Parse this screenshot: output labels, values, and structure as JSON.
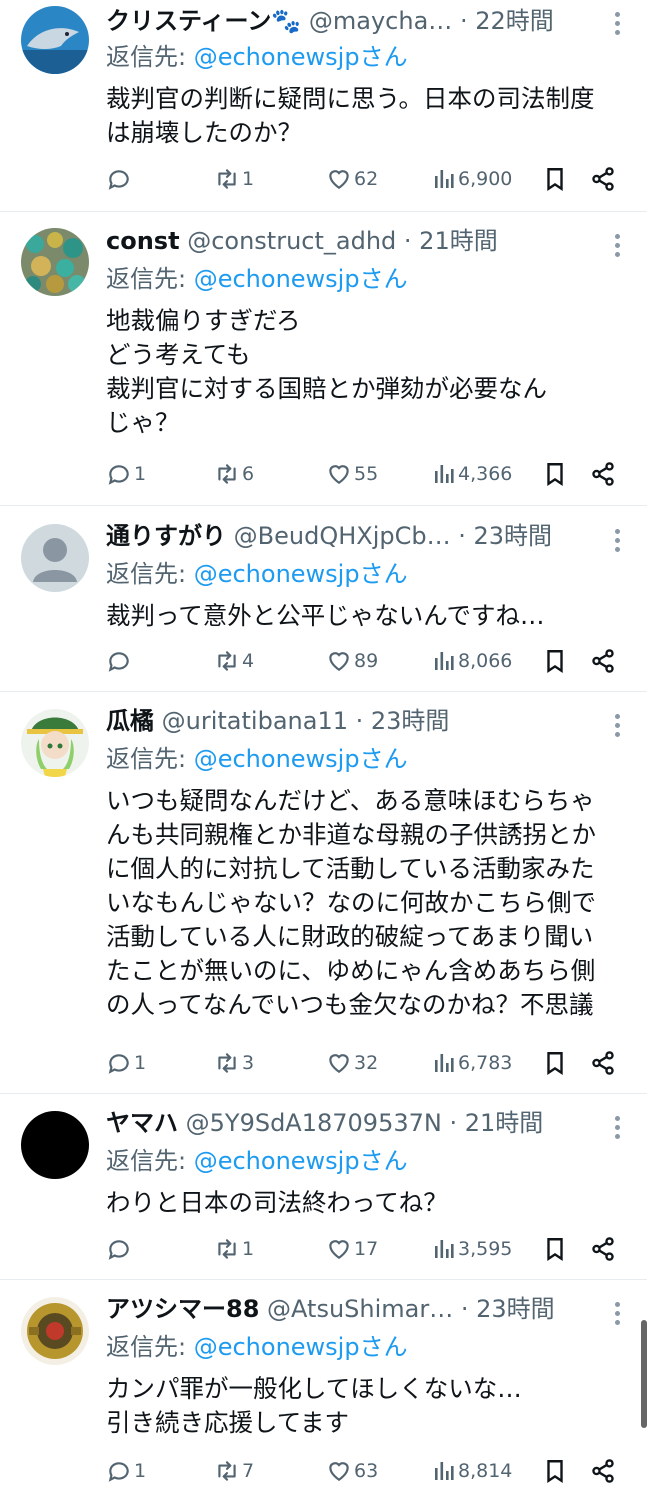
{
  "reply_prefix": "返信先: ",
  "tweets": [
    {
      "name": "クリスティーン🐾",
      "handle": "@maycha…",
      "time": "· 22時間",
      "reply_to": "@echonewsjpさん",
      "lines": [
        "裁判官の判断に疑問に思う。日本の司法制度",
        "は崩壊したのか？"
      ],
      "replies": "",
      "retweets": "1",
      "likes": "62",
      "views": "6,900",
      "avatar": "dolphin"
    },
    {
      "name": "const",
      "handle": "@construct_adhd",
      "time": "· 21時間",
      "reply_to": "@echonewsjpさん",
      "lines": [
        "地裁偏りすぎだろ",
        "どう考えても",
        "裁判官に対する国賠とか弾劾が必要なん",
        "じゃ？"
      ],
      "replies": "1",
      "retweets": "6",
      "likes": "55",
      "views": "4,366",
      "avatar": "gravel"
    },
    {
      "name": "通りすがり",
      "handle": "@BeudQHXjpCb…",
      "time": "· 23時間",
      "reply_to": "@echonewsjpさん",
      "lines": [
        "裁判って意外と公平じゃないんですね…"
      ],
      "replies": "",
      "retweets": "4",
      "likes": "89",
      "views": "8,066",
      "avatar": "default"
    },
    {
      "name": "瓜橘",
      "handle": "@uritatibana11",
      "time": "· 23時間",
      "reply_to": "@echonewsjpさん",
      "lines": [
        "いつも疑問なんだけど、ある意味ほむらちゃ",
        "んも共同親権とか非道な母親の子供誘拐とか",
        "に個人的に対抗して活動している活動家みた",
        "いなもんじゃない？なのに何故かこちら側で",
        "活動している人に財政的破綻ってあまり聞い",
        "たことが無いのに、ゆめにゃん含めあちら側",
        "の人ってなんでいつも金欠なのかね？不思議"
      ],
      "replies": "1",
      "retweets": "3",
      "likes": "32",
      "views": "6,783",
      "avatar": "anime"
    },
    {
      "name": "ヤマハ",
      "handle": "@5Y9SdA18709537N",
      "time": "· 21時間",
      "reply_to": "@echonewsjpさん",
      "lines": [
        "わりと日本の司法終わってね？"
      ],
      "replies": "",
      "retweets": "1",
      "likes": "17",
      "views": "3,595",
      "avatar": "black"
    },
    {
      "name": "アツシマー88",
      "handle": "@AtsuShimar…",
      "time": "· 23時間",
      "reply_to": "@echonewsjpさん",
      "lines": [
        "カンパ罪が一般化してほしくないな…",
        "引き続き応援してます"
      ],
      "replies": "1",
      "retweets": "7",
      "likes": "63",
      "views": "8,814",
      "avatar": "robot"
    }
  ]
}
